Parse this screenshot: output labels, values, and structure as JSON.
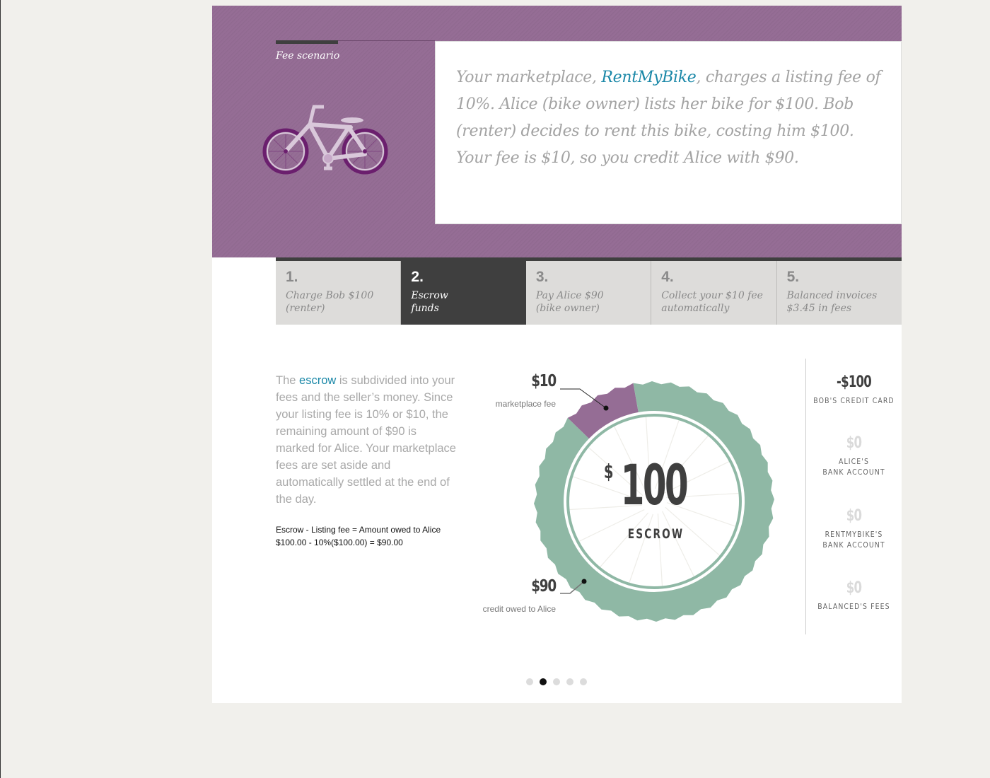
{
  "hero": {
    "section_label": "Fee scenario",
    "bike_icon": "bicycle-icon",
    "intro_before": "Your marketplace, ",
    "intro_brand": "RentMyBike",
    "intro_after": ", charges a listing fee of 10%. Alice (bike owner) lists her bike for $100. Bob (renter) decides to rent this bike, costing him $100. Your fee is $10, so you credit Alice with $90."
  },
  "steps": [
    {
      "num": "1.",
      "text": "Charge Bob $100\n(renter)",
      "active": false
    },
    {
      "num": "2.",
      "text": "Escrow\nfunds",
      "active": true
    },
    {
      "num": "3.",
      "text": "Pay Alice $90\n(bike owner)",
      "active": false
    },
    {
      "num": "4.",
      "text": "Collect your $10 fee\nautomatically",
      "active": false
    },
    {
      "num": "5.",
      "text": "Balanced invoices\n$3.45 in fees",
      "active": false
    }
  ],
  "explanation": {
    "before": "The ",
    "link": "escrow",
    "after": " is subdivided into your fees and the seller’s money. Since your listing fee is 10% or $10, the remaining amount of $90 is marked for Alice. Your marketplace fees are set aside and automatically settled at the end of the day.",
    "formula_line1": "Escrow - Listing fee = Amount owed to Alice",
    "formula_line2": "$100.00 - 10%($100.00) = $90.00"
  },
  "escrow": {
    "currency": "$",
    "total": "100",
    "label": "ESCROW",
    "colors": {
      "fee": "#956d95",
      "seller": "#8fb8a5"
    },
    "segments": [
      {
        "amount": "$10",
        "label": "marketplace fee",
        "value": 10
      },
      {
        "amount": "$90",
        "label": "credit owed to Alice",
        "value": 90
      }
    ]
  },
  "accounts": [
    {
      "amount": "-$100",
      "name": "BOB'S CREDIT CARD",
      "zero": false
    },
    {
      "amount": "$0",
      "name": "ALICE'S\nBANK ACCOUNT",
      "zero": true
    },
    {
      "amount": "$0",
      "name": "RENTMYBIKE'S\nBANK ACCOUNT",
      "zero": true
    },
    {
      "amount": "$0",
      "name": "BALANCED'S FEES",
      "zero": true
    }
  ],
  "pagination": {
    "total": 5,
    "current": 2
  }
}
